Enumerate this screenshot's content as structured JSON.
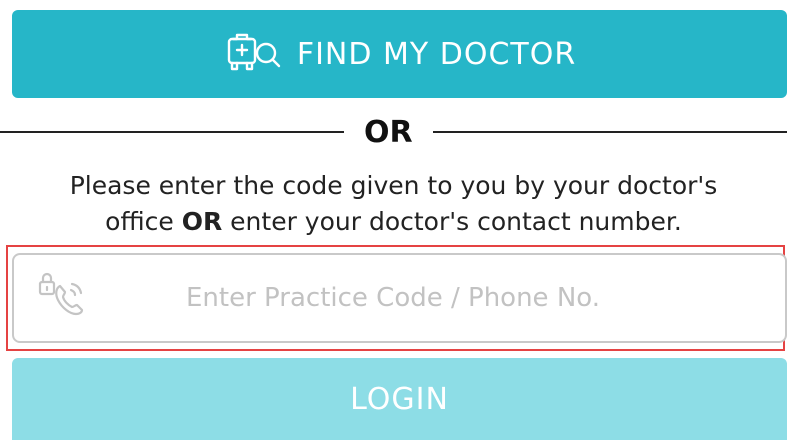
{
  "find_button": {
    "label": "FIND MY DOCTOR",
    "icon": "medical-kit-search-icon",
    "color": "#26b6c8"
  },
  "divider": {
    "label": "OR"
  },
  "instruction": {
    "part1": "Please enter the code given to you by your doctor's",
    "part2a": "office ",
    "part2b": "OR",
    "part2c": " enter your doctor's contact number."
  },
  "code_input": {
    "placeholder": "Enter Practice Code / Phone No.",
    "value": "",
    "icon": "lock-phone-icon"
  },
  "login_button": {
    "label": "LOGIN",
    "color": "#8ddde6"
  }
}
